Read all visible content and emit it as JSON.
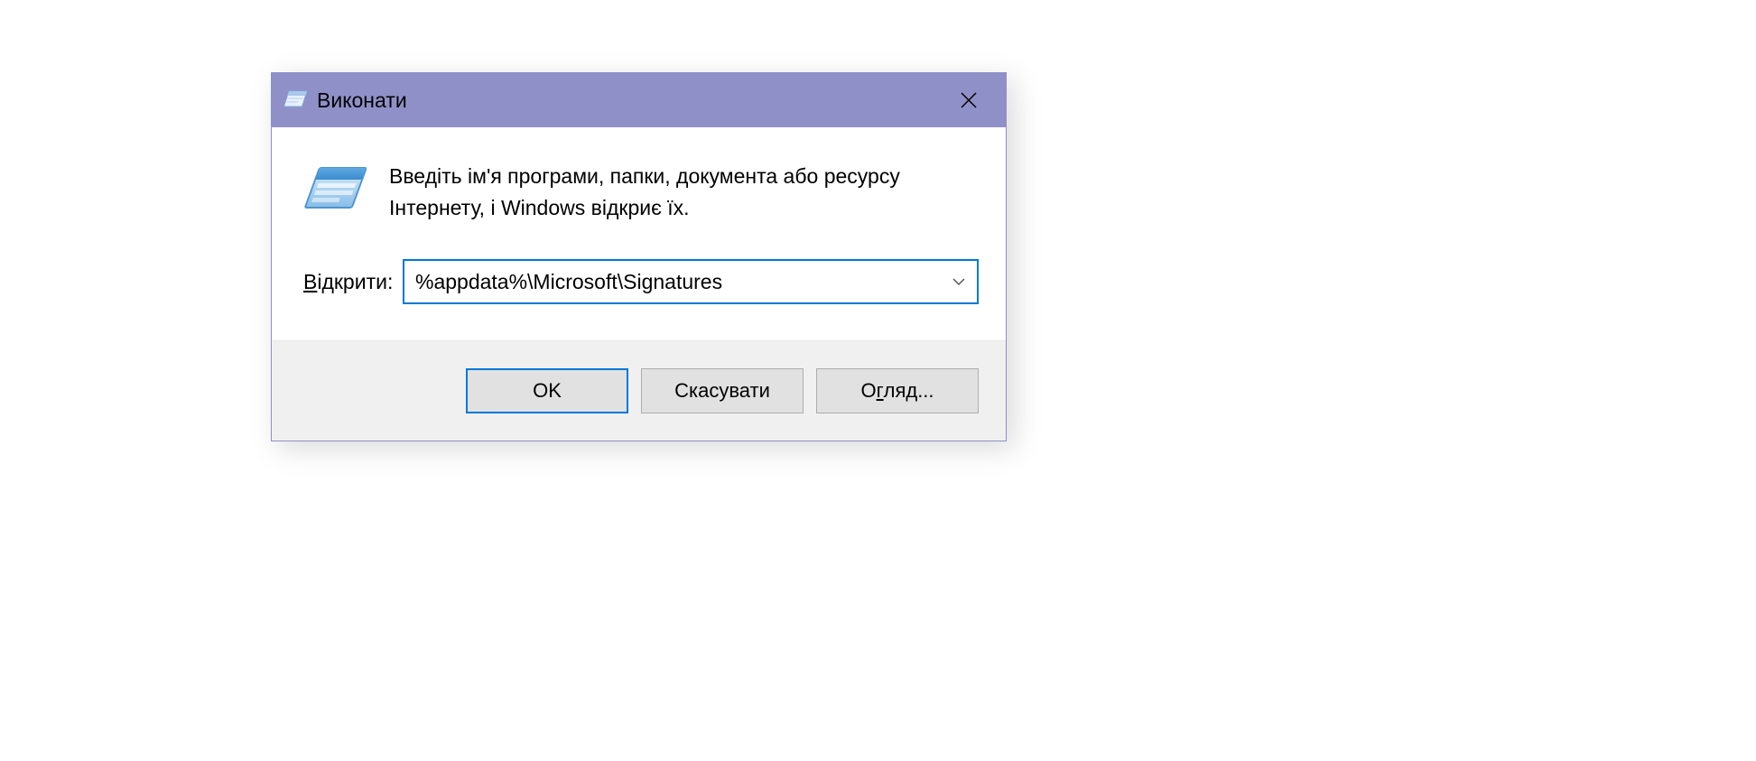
{
  "dialog": {
    "title": "Виконати",
    "info_text": "Введіть ім'я програми, папки, документа або ресурсу Інтернету, і Windows відкриє їх.",
    "open_label_prefix": "В",
    "open_label_rest": "ідкрити:",
    "open_value": "%appdata%\\Microsoft\\Signatures",
    "buttons": {
      "ok": "OK",
      "cancel": "Скасувати",
      "browse_prefix": "О",
      "browse_underline": "г",
      "browse_rest": "ляд..."
    }
  }
}
